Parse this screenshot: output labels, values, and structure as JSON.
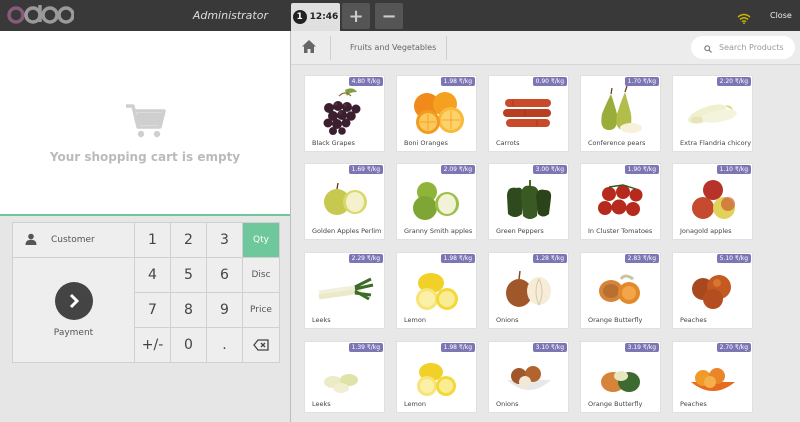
{
  "header": {
    "logo_text": "odoo",
    "user": "Administrator",
    "order_number": "1",
    "order_time": "12:46",
    "add_label": "+",
    "remove_label": "−",
    "close_label": "Close"
  },
  "cart": {
    "empty_text": "Your shopping cart is empty"
  },
  "numpad": {
    "customer_label": "Customer",
    "payment_label": "Payment",
    "keys": [
      "1",
      "2",
      "3",
      "4",
      "5",
      "6",
      "7",
      "8",
      "9",
      "+/-",
      "0",
      "."
    ],
    "modes": [
      "Qty",
      "Disc",
      "Price"
    ],
    "active_mode": "Qty"
  },
  "breadcrumb": {
    "category": "Fruits and Vegetables"
  },
  "search": {
    "placeholder": "Search Products"
  },
  "colors": {
    "accent": "#6ec89b",
    "price_badge": "#7d76b5",
    "topbar": "#393939",
    "logo": "#875a7b"
  },
  "products": [
    {
      "name": "Black Grapes",
      "price": "4.80 ₹/kg",
      "icon": "grapes"
    },
    {
      "name": "Boni Oranges",
      "price": "1.98 ₹/kg",
      "icon": "oranges"
    },
    {
      "name": "Carrots",
      "price": "0.90 ₹/kg",
      "icon": "carrots"
    },
    {
      "name": "Conference pears",
      "price": "1.70 ₹/kg",
      "icon": "pears"
    },
    {
      "name": "Extra Flandria chicory",
      "price": "2.20 ₹/kg",
      "icon": "chicory"
    },
    {
      "name": "Golden Apples Perlim",
      "price": "1.69 ₹/kg",
      "icon": "golden-apples"
    },
    {
      "name": "Granny Smith apples",
      "price": "2.09 ₹/kg",
      "icon": "green-apples"
    },
    {
      "name": "Green Peppers",
      "price": "3.00 ₹/kg",
      "icon": "peppers"
    },
    {
      "name": "In Cluster Tomatoes",
      "price": "1.90 ₹/kg",
      "icon": "tomatoes"
    },
    {
      "name": "Jonagold apples",
      "price": "1.10 ₹/kg",
      "icon": "red-apples"
    },
    {
      "name": "Leeks",
      "price": "2.29 ₹/kg",
      "icon": "leeks"
    },
    {
      "name": "Lemon",
      "price": "1.98 ₹/kg",
      "icon": "lemons"
    },
    {
      "name": "Onions",
      "price": "1.28 ₹/kg",
      "icon": "onions"
    },
    {
      "name": "Orange Butterfly",
      "price": "2.83 ₹/kg",
      "icon": "squash"
    },
    {
      "name": "Peaches",
      "price": "5.10 ₹/kg",
      "icon": "peaches"
    },
    {
      "name": "Leeks",
      "price": "1.39 ₹/kg",
      "icon": "leeks-cut"
    },
    {
      "name": "Lemon",
      "price": "1.98 ₹/kg",
      "icon": "lemons"
    },
    {
      "name": "Onions",
      "price": "3.10 ₹/kg",
      "icon": "onions-bowl"
    },
    {
      "name": "Orange Butterfly",
      "price": "3.19 ₹/kg",
      "icon": "squash"
    },
    {
      "name": "Peaches",
      "price": "2.70 ₹/kg",
      "icon": "peaches-bowl"
    }
  ]
}
